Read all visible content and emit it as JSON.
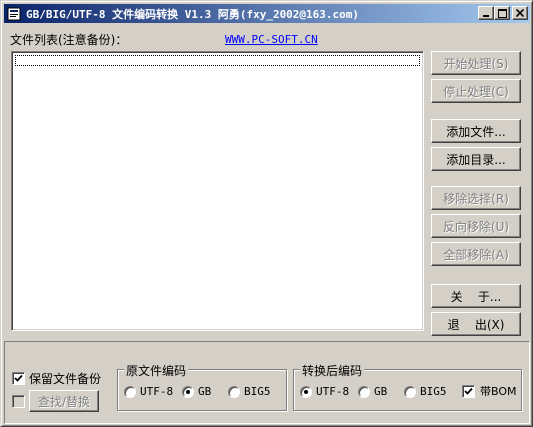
{
  "window": {
    "title": "GB/BIG/UTF-8 文件编码转换 V1.3  阿勇(fxy_2002@163.com)",
    "icon": "app-icon",
    "controls": {
      "minimize": "_",
      "maximize": "□",
      "close": "×"
    }
  },
  "header": {
    "file_list_label": "文件列表(注意备份)：",
    "website_link": "WWW.PC-SOFT.CN"
  },
  "buttons": {
    "start": "开始处理(S)",
    "stop": "停止处理(C)",
    "add_file": "添加文件...",
    "add_dir": "添加目录...",
    "remove_selected": "移除选择(R)",
    "reverse_remove": "反向移除(U)",
    "remove_all": "全部移除(A)",
    "about": "关    于...",
    "exit": "退    出(X)"
  },
  "bottom": {
    "keep_backup_label": "保留文件备份",
    "keep_backup_checked": true,
    "find_replace_checked": false,
    "find_replace_button": "查找/替换",
    "source_group": {
      "title": "原文件编码",
      "options": [
        "UTF-8",
        "GB",
        "BIG5"
      ],
      "selected": "GB"
    },
    "target_group": {
      "title": "转换后编码",
      "options": [
        "UTF-8",
        "GB",
        "BIG5"
      ],
      "selected": "UTF-8",
      "bom_label": "带BOM",
      "bom_checked": true
    }
  },
  "colors": {
    "title_gradient_start": "#0a246a",
    "title_gradient_end": "#a6caf0",
    "window_bg": "#d4d0c8",
    "link": "#0000ff"
  }
}
